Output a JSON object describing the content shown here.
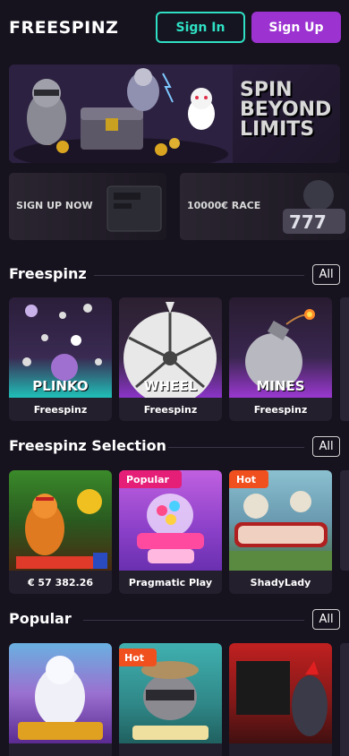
{
  "header": {
    "logo": "FREESPINZ",
    "signin_label": "Sign In",
    "signup_label": "Sign Up"
  },
  "hero": {
    "headline": "SPIN BEYOND LIMITS"
  },
  "promos": [
    {
      "label": "SIGN UP NOW"
    },
    {
      "label": "10000€ RACE"
    }
  ],
  "sections": {
    "freespinz": {
      "title": "Freespinz",
      "all_label": "All",
      "games": [
        {
          "title": "PLINKO",
          "provider": "Freespinz"
        },
        {
          "title": "WHEEL",
          "provider": "Freespinz"
        },
        {
          "title": "MINES",
          "provider": "Freespinz"
        }
      ]
    },
    "selection": {
      "title": "Freespinz Selection",
      "all_label": "All",
      "games": [
        {
          "provider": "€ 57 382.26",
          "badge": ""
        },
        {
          "provider": "Pragmatic Play",
          "badge": "Popular"
        },
        {
          "provider": "ShadyLady",
          "badge": "Hot"
        }
      ]
    },
    "popular": {
      "title": "Popular",
      "all_label": "All",
      "games": [
        {
          "badge": ""
        },
        {
          "badge": "Hot"
        },
        {
          "badge": ""
        }
      ]
    }
  },
  "colors": {
    "background": "#16121e",
    "accent_teal": "#2fe0c4",
    "accent_purple": "#9c33d1",
    "badge_popular": "#e51e78",
    "badge_hot": "#f0501e"
  }
}
